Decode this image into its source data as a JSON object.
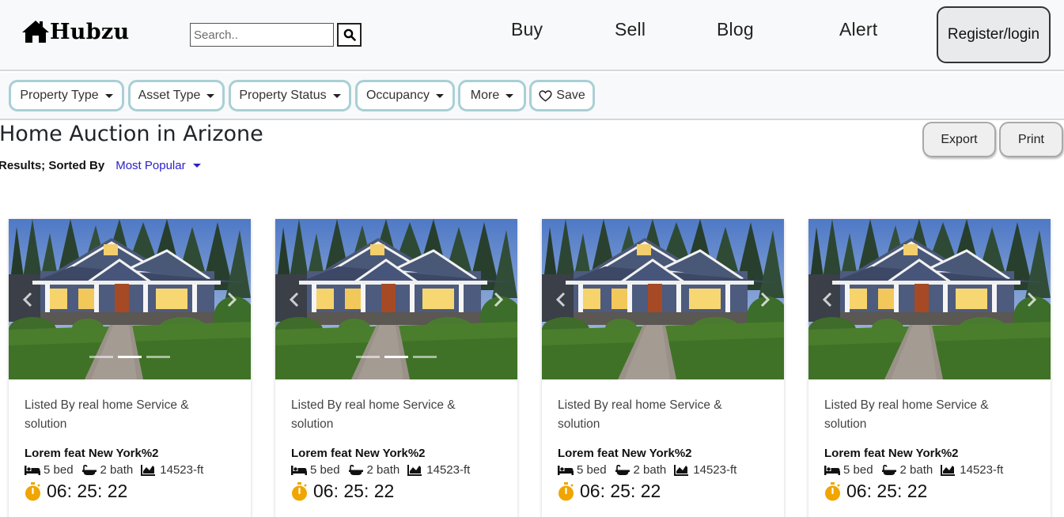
{
  "header": {
    "logo_text": "Hubzu",
    "search_placeholder": "Search..",
    "nav": [
      "Buy",
      "Sell",
      "Blog",
      "Alert"
    ],
    "register_label": "Register/login"
  },
  "filters": {
    "chips": [
      "Property Type",
      "Asset Type",
      "Property Status",
      "Occupancy",
      "More"
    ],
    "save_label": "Save"
  },
  "page": {
    "title": "Home Auction in Arizone",
    "results_label": "Results; Sorted By",
    "sort_value": "Most Popular",
    "export_label": "Export",
    "print_label": "Print"
  },
  "cards": [
    {
      "listed_by": "Listed By real home Service & solution",
      "title": "Lorem feat New York%2",
      "beds": "5 bed",
      "baths": "2 bath",
      "area": "14523-ft",
      "timer": "06: 25: 22",
      "active_slide": 2,
      "slides": 3
    },
    {
      "listed_by": "Listed By real home Service & solution",
      "title": "Lorem feat New York%2",
      "beds": "5 bed",
      "baths": "2 bath",
      "area": "14523-ft",
      "timer": "06: 25: 22",
      "active_slide": 2,
      "slides": 3
    },
    {
      "listed_by": "Listed By real home Service & solution",
      "title": "Lorem feat New York%2",
      "beds": "5 bed",
      "baths": "2 bath",
      "area": "14523-ft",
      "timer": "06: 25: 22",
      "active_slide": 0,
      "slides": 0
    },
    {
      "listed_by": "Listed By real home Service & solution",
      "title": "Lorem feat New York%2",
      "beds": "5 bed",
      "baths": "2 bath",
      "area": "14523-ft",
      "timer": "06: 25: 22",
      "active_slide": 0,
      "slides": 0
    }
  ],
  "colors": {
    "chip_border": "#a9cfd6",
    "link_blue": "#2b21c9",
    "timer_orange": "#f0a500"
  },
  "icons": {
    "logo": "house-icon",
    "search": "search-icon",
    "save": "heart-icon",
    "bed": "bed-icon",
    "bath": "bath-icon",
    "area": "area-chart-icon",
    "timer": "stopwatch-icon",
    "prev": "chevron-left-icon",
    "next": "chevron-right-icon"
  }
}
